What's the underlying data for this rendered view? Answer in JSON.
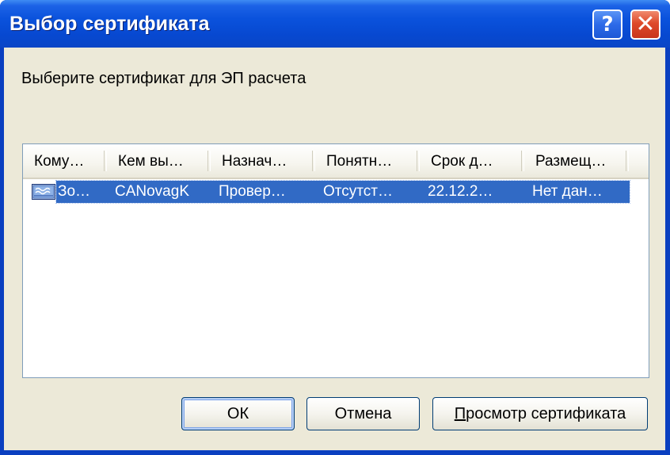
{
  "window": {
    "title": "Выбор сертификата",
    "help_button": "?",
    "close_button": "✕"
  },
  "prompt": "Выберите сертификат для ЭП расчета",
  "table": {
    "columns": [
      "Кому…",
      "Кем вы…",
      "Назнач…",
      "Понятн…",
      "Срок д…",
      "Размещ…"
    ],
    "rows": [
      {
        "selected": true,
        "icon": "certificate-icon",
        "cells": [
          "Зо…",
          "CANovagK",
          "Провер…",
          "Отсутст…",
          "22.12.2…",
          "Нет дан…"
        ]
      }
    ]
  },
  "buttons": {
    "ok": "ОК",
    "cancel": "Отмена",
    "view_first": "П",
    "view_rest": "росмотр сертификата"
  },
  "colors": {
    "title_bar": "#0a52dc",
    "selection": "#316ac5",
    "dialog_bg": "#ece9d8",
    "close_button": "#de4a2a"
  }
}
